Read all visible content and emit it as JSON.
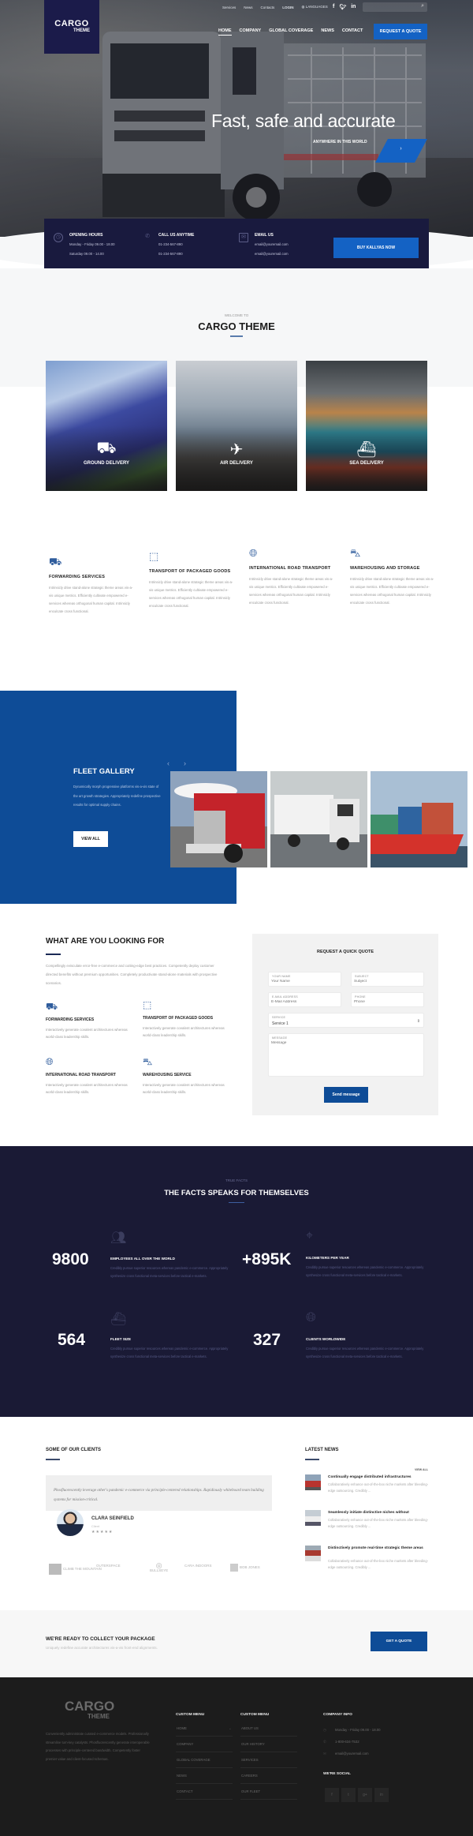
{
  "header": {
    "logo": {
      "line1": "CARGO",
      "line2": "THEME"
    },
    "top_links": [
      "Services",
      "News",
      "Contacts"
    ],
    "login": "LOGIN",
    "language": "LANGUAGES",
    "social_icons": [
      "facebook-icon",
      "twitter-icon",
      "linkedin-icon"
    ],
    "search_placeholder": "",
    "nav": [
      {
        "label": "HOME",
        "active": true
      },
      {
        "label": "COMPANY",
        "active": false
      },
      {
        "label": "GLOBAL COVERAGE",
        "active": false
      },
      {
        "label": "NEWS",
        "active": false
      },
      {
        "label": "CONTACT",
        "active": false
      }
    ],
    "quote_button": "REQUEST A QUOTE"
  },
  "hero": {
    "title": "Fast, safe and accurate",
    "subtitle": "ANYWHERE IN THIS WORLD",
    "next_arrow": "›"
  },
  "info_bar": {
    "opening": {
      "title": "OPENING HOURS",
      "lines": [
        "Monday - Friday 09.00 - 18.00",
        "Saturday 09.00 - 14.00"
      ]
    },
    "call": {
      "title": "CALL US ANYTIME",
      "lines": [
        "01-234-567-890",
        "01-234-567-890"
      ]
    },
    "email": {
      "title": "EMAIL US",
      "lines": [
        "email@youremail.com",
        "email@youremail.com"
      ]
    },
    "button": "BUY KALLYAS NOW"
  },
  "welcome": {
    "kicker": "WELCOME TO",
    "title": "CARGO THEME",
    "cards": [
      {
        "label": "GROUND DELIVERY",
        "icon": "truck-icon"
      },
      {
        "label": "AIR DELIVERY",
        "icon": "airplane-icon"
      },
      {
        "label": "SEA DELIVERY",
        "icon": "ship-icon"
      }
    ]
  },
  "features": [
    {
      "title": "FORWARDING SERVICES",
      "text": "Intrinsicly drive stand-alone strategic theme areas vis-a-vis unique metrics. Efficiently cultivate empowered e-services whereas orthogonal human capital. Intrinsicly enculcate cross functional.",
      "icon": "truck-icon"
    },
    {
      "title": "TRANSPORT OF PACKAGED GOODS",
      "text": "Intrinsicly drive stand-alone strategic theme areas vis-a-vis unique metrics. Efficiently cultivate empowered e-services whereas orthogonal human capital. Intrinsicly enculcate cross functional.",
      "icon": "package-icon"
    },
    {
      "title": "INTERNATIONAL ROAD TRANSPORT",
      "text": "Intrinsicly drive stand-alone strategic theme areas vis-a-vis unique metrics. Efficiently cultivate empowered e-services whereas orthogonal human capital. Intrinsicly enculcate cross functional.",
      "icon": "globe-icon"
    },
    {
      "title": "WAREHOUSING AND STORAGE",
      "text": "Intrinsicly drive stand-alone strategic theme areas vis-a-vis unique metrics. Efficiently cultivate empowered e-services whereas orthogonal human capital. Intrinsicly enculcate cross functional.",
      "icon": "forklift-icon"
    }
  ],
  "fleet": {
    "title": "FLEET GALLERY",
    "text": "Dynamically morph progressive platforms vis-a-vis state of the art growth strategies. Appropriately redefine prospective results for optimal supply chains.",
    "button": "VIEW ALL",
    "prev": "‹",
    "next": "›",
    "images": [
      "red-truck-image",
      "white-truck-image",
      "cargo-ship-image"
    ]
  },
  "looking_for": {
    "title": "WHAT ARE YOU LOOKING FOR",
    "text": "Compellingly evisculate error-free e-commerce and cutting-edge best practices. Competently deploy customer directed benefits without premium opportunities. Completely productivate stand-alone materials with prospective scenarios.",
    "items": [
      {
        "title": "FORWARDING SERVICES",
        "text": "Interactively generate covalent architectures whereas world-class leadership skills.",
        "icon": "truck-icon"
      },
      {
        "title": "TRANSPORT OF PACKAGED GOODS",
        "text": "Interactively generate covalent architectures whereas world-class leadership skills.",
        "icon": "package-icon"
      },
      {
        "title": "INTERNATIONAL ROAD TRANSPORT",
        "text": "Interactively generate covalent architectures whereas world-class leadership skills.",
        "icon": "globe-icon"
      },
      {
        "title": "WAREHOUSING SERVICE",
        "text": "Interactively generate covalent architectures whereas world-class leadership skills.",
        "icon": "forklift-icon"
      }
    ]
  },
  "quote_form": {
    "title": "REQUEST A QUICK QUOTE",
    "name": {
      "label": "YOUR NAME",
      "placeholder": "Your Name"
    },
    "subject": {
      "label": "SUBJECT",
      "placeholder": "Subject"
    },
    "email": {
      "label": "E-MAIL ADDRESS",
      "placeholder": "E-Mail Address"
    },
    "phone": {
      "label": "PHONE",
      "placeholder": "Phone"
    },
    "service": {
      "label": "SERVICE",
      "value": "Service 1"
    },
    "message": {
      "label": "MESSAGE",
      "placeholder": "Message"
    },
    "submit": "Send message"
  },
  "facts": {
    "kicker": "TRUE FACTS",
    "title": "THE FACTS SPEAKS FOR THEMSELVES",
    "items": [
      {
        "number": "9800",
        "title": "EMPLOYEES ALL OVER THE WORLD",
        "text": "Credibly pursue superior resources whereas pandemic e-commerce. Appropriately synthesize cross functional meta-services before tactical e-markets.",
        "icon": "team-icon"
      },
      {
        "number": "+895K",
        "title": "KILOMETERS PER YEAR",
        "text": "Credibly pursue superior resources whereas pandemic e-commerce. Appropriately synthesize cross functional meta-services before tactical e-markets.",
        "icon": "route-pin-icon"
      },
      {
        "number": "564",
        "title": "FLEET SIZE",
        "text": "Credibly pursue superior resources whereas pandemic e-commerce. Appropriately synthesize cross functional meta-services before tactical e-markets.",
        "icon": "ship-icon"
      },
      {
        "number": "327",
        "title": "CLIENTS WORLDWIDE",
        "text": "Credibly pursue superior resources whereas pandemic e-commerce. Appropriately synthesize cross functional meta-services before tactical e-markets.",
        "icon": "globe-icon"
      }
    ]
  },
  "clients": {
    "title": "SOME OF OUR CLIENTS",
    "quote": "Phosfluorescently leverage other's pandemic e-commerce via principle-centered relationships. Rapidiously whiteboard team building systems for mission-critical.",
    "name": "CLARA SEINFIELD",
    "role": "Client",
    "stars": "★★★★★",
    "rating": 5,
    "logos": [
      "CLIMB THE MOUNTAIN",
      "OUTERSPACE",
      "BULLSEYE",
      "CARA INDOORS",
      "BOB JONES"
    ]
  },
  "news": {
    "title": "LATEST NEWS",
    "view_all": "VIEW ALL",
    "items": [
      {
        "title": "Continually engage distributed infrastructures",
        "text": "Collaboratively enhance out-of-the-box niche markets after bleeding-edge outsourcing. Credibly ..."
      },
      {
        "title": "Seamlessly initiate distinctive niches without",
        "text": "Collaboratively enhance out-of-the-box niche markets after bleeding-edge outsourcing. Credibly ..."
      },
      {
        "title": "Distinctively promote real-time strategic theme areas",
        "text": "Collaboratively enhance out-of-the-box niche markets after bleeding-edge outsourcing. Credibly ..."
      }
    ]
  },
  "cta": {
    "title": "WE'RE READY TO COLLECT YOUR PACKAGE",
    "text": "Uniquely redefine accurate architectures vis-a-vis front-end alignments.",
    "button": "GET A QUOTE"
  },
  "footer": {
    "logo": {
      "line1": "CARGO",
      "line2": "THEME"
    },
    "about": "Conveniently administrate curated e-commerce models. Professionally streamline turn-key catalysts. Phosfluorescently generate interoperable processes with principle-centered bandwidth. Competently foster premier value and client-focused schemas.",
    "menu1": {
      "title": "CUSTOM MENU",
      "items": [
        "HOME",
        "COMPANY",
        "GLOBAL COVERAGE",
        "NEWS",
        "CONTACT"
      ]
    },
    "menu2": {
      "title": "CUSTOM MENU",
      "items": [
        "ABOUT US",
        "OUR HISTORY",
        "SERVICES",
        "CAREERS",
        "OUR FLEET"
      ]
    },
    "company": {
      "title": "COMPANY INFO",
      "hours": "Monday - Friday 09.00 - 18.00",
      "phone": "1-800-634-7532",
      "email": "email@youremail.com"
    },
    "social": {
      "title": "WE'RE SOCIAL",
      "icons": [
        "f",
        "t",
        "g+",
        "in"
      ]
    }
  },
  "colors": {
    "navy": "#1a1a35",
    "primary_blue": "#0e4c97",
    "accent_blue": "#1462c4",
    "footer": "#1c1c1c"
  }
}
